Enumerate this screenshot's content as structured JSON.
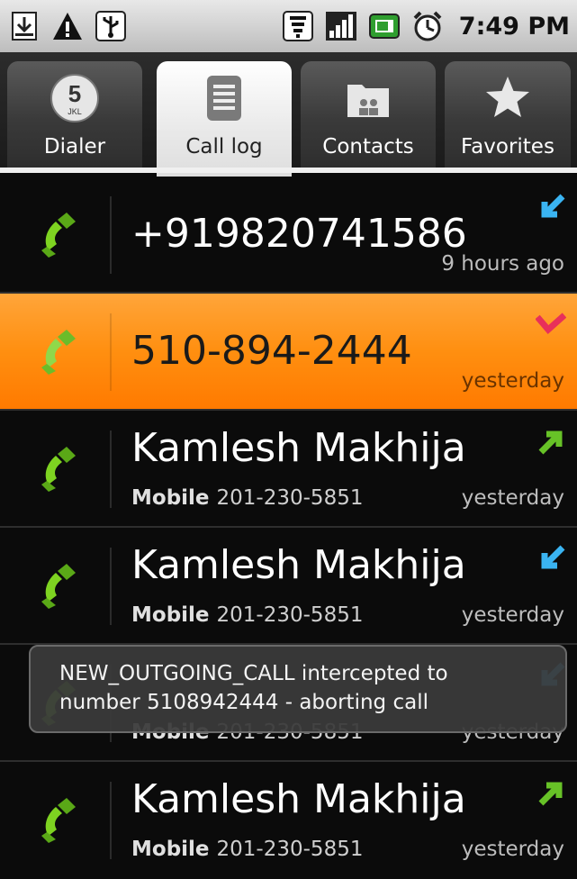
{
  "status_bar": {
    "time": "7:49 PM",
    "left_icons": [
      "download-icon",
      "warning-icon",
      "usb-icon"
    ],
    "right_icons": [
      "wifi-icon",
      "signal-icon",
      "battery-icon",
      "alarm-icon"
    ]
  },
  "tabs": [
    {
      "label": "Dialer",
      "icon": "dialpad-5-icon",
      "active": false
    },
    {
      "label": "Call log",
      "icon": "list-icon",
      "active": true
    },
    {
      "label": "Contacts",
      "icon": "contacts-folder-icon",
      "active": false
    },
    {
      "label": "Favorites",
      "icon": "star-icon",
      "active": false
    }
  ],
  "calls": [
    {
      "name": "+919820741586",
      "type_label": "",
      "number": "",
      "time": "9 hours ago",
      "call_type": "incoming",
      "highlighted": false
    },
    {
      "name": "510-894-2444",
      "type_label": "",
      "number": "",
      "time": "yesterday",
      "call_type": "missed",
      "highlighted": true
    },
    {
      "name": "Kamlesh Makhija",
      "type_label": "Mobile",
      "number": "201-230-5851",
      "time": "yesterday",
      "call_type": "outgoing",
      "highlighted": false
    },
    {
      "name": "Kamlesh Makhija",
      "type_label": "Mobile",
      "number": "201-230-5851",
      "time": "yesterday",
      "call_type": "incoming",
      "highlighted": false
    },
    {
      "name": "",
      "type_label": "Mobile",
      "number": "201-230-5851",
      "time": "yesterday",
      "call_type": "incoming",
      "highlighted": false
    },
    {
      "name": "Kamlesh Makhija",
      "type_label": "Mobile",
      "number": "201-230-5851",
      "time": "yesterday",
      "call_type": "outgoing",
      "highlighted": false
    }
  ],
  "toast": {
    "message": "NEW_OUTGOING_CALL intercepted to\nnumber 5108942444 - aborting call"
  },
  "colors": {
    "highlight": "#ff8c00",
    "phone_green": "#7ed321",
    "incoming_arrow": "#3ab4f2",
    "outgoing_arrow": "#67c227",
    "missed_arrow": "#e8305a"
  }
}
